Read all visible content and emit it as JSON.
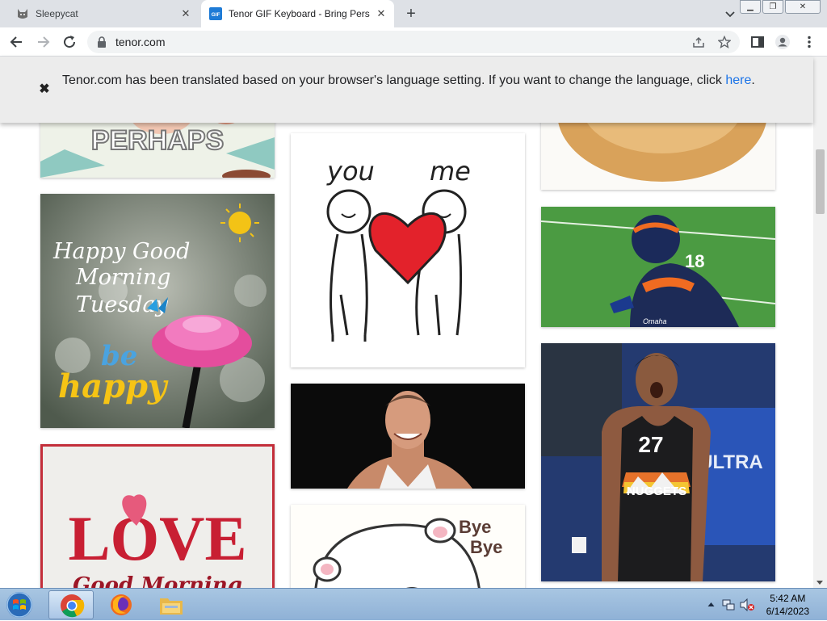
{
  "browser": {
    "tabs": [
      {
        "title": "Sleepycat",
        "favicon": "cat-icon",
        "active": false
      },
      {
        "title": "Tenor GIF Keyboard - Bring Perso",
        "favicon": "tenor-gif-icon",
        "favicon_text": "GIF",
        "active": true
      }
    ],
    "new_tab_label": "+",
    "address": "tenor.com",
    "window_controls": [
      "minimize",
      "restore",
      "close"
    ]
  },
  "notice": {
    "message": "Tenor.com has been translated based on your browser's language setting. If you want to change the language, click",
    "link_text": "here",
    "link_suffix": "."
  },
  "gifs": [
    {
      "name": "perhaps-gif",
      "caption": "PERHAPS"
    },
    {
      "name": "you-me-heart-gif",
      "texts": [
        "you",
        "me"
      ]
    },
    {
      "name": "cat-gif"
    },
    {
      "name": "happy-good-morning-tuesday-gif",
      "texts": [
        "Happy Good",
        "Morning",
        "Tuesday",
        "be",
        "happy"
      ]
    },
    {
      "name": "broncos-player-gif",
      "texts": [
        "18",
        "Omaha"
      ]
    },
    {
      "name": "basketball-player-smiling-gif"
    },
    {
      "name": "nuggets-player-gif",
      "texts": [
        "27",
        "NUGGETS",
        "ULTRA"
      ]
    },
    {
      "name": "love-good-morning-gif",
      "texts": [
        "LOVE",
        "Good Morning"
      ]
    },
    {
      "name": "bye-bye-bear-gif",
      "texts": [
        "Bye",
        "Bye"
      ]
    }
  ],
  "taskbar": {
    "apps": [
      "chrome-icon",
      "firefox-icon",
      "file-explorer-icon"
    ],
    "time": "5:42 AM",
    "date": "6/14/2023"
  },
  "colors": {
    "link": "#1a73e8",
    "tab_strip": "#dee1e6",
    "notice_bg": "#ececec"
  }
}
